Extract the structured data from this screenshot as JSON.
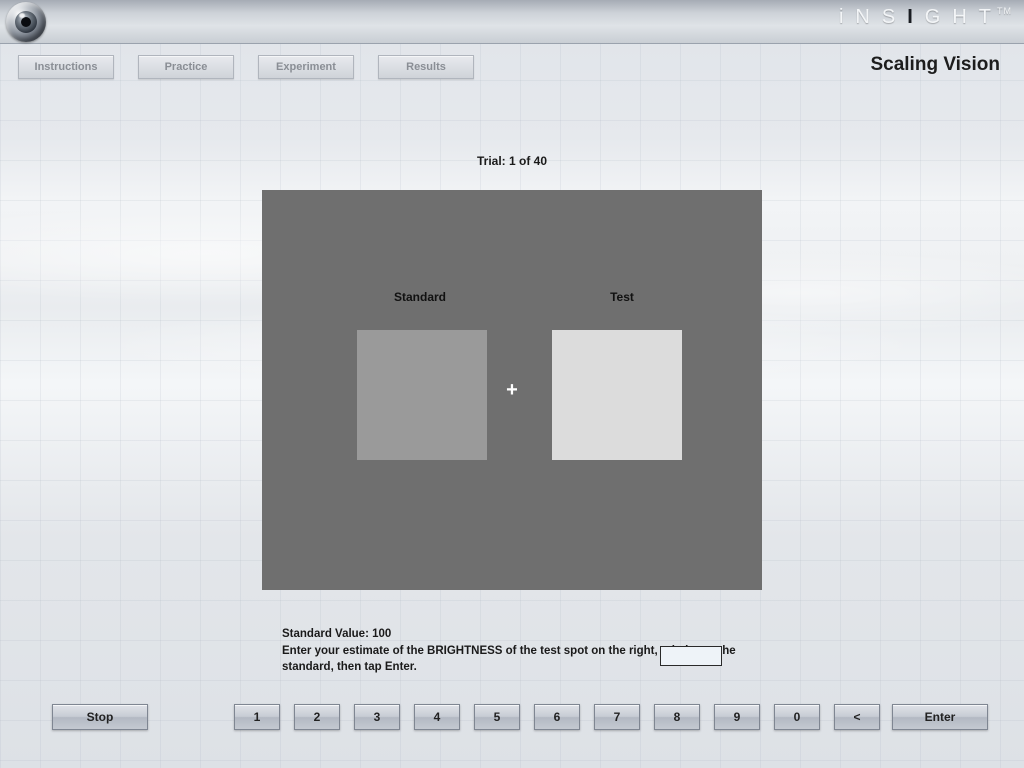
{
  "brand": {
    "name": "iNSIGHT",
    "tm": "TM"
  },
  "tabs": {
    "instructions": "Instructions",
    "practice": "Practice",
    "experiment": "Experiment",
    "results": "Results"
  },
  "page_title": "Scaling Vision",
  "trial": {
    "label": "Trial: 1 of 40",
    "current": 1,
    "total": 40
  },
  "stimulus": {
    "standard_label": "Standard",
    "test_label": "Test",
    "fixation": "+",
    "standard_color": "#9a9a9a",
    "test_color": "#dcdcdc",
    "bg_color": "#6f6f6f"
  },
  "prompt": {
    "line1": "Standard Value: 100",
    "standard_value": 100,
    "line2": "Enter your estimate of the BRIGHTNESS of the test spot on the right, relative to the standard, then tap Enter."
  },
  "input": {
    "value": ""
  },
  "keypad": {
    "k1": "1",
    "k2": "2",
    "k3": "3",
    "k4": "4",
    "k5": "5",
    "k6": "6",
    "k7": "7",
    "k8": "8",
    "k9": "9",
    "k0": "0",
    "back": "<"
  },
  "buttons": {
    "stop": "Stop",
    "enter": "Enter"
  }
}
